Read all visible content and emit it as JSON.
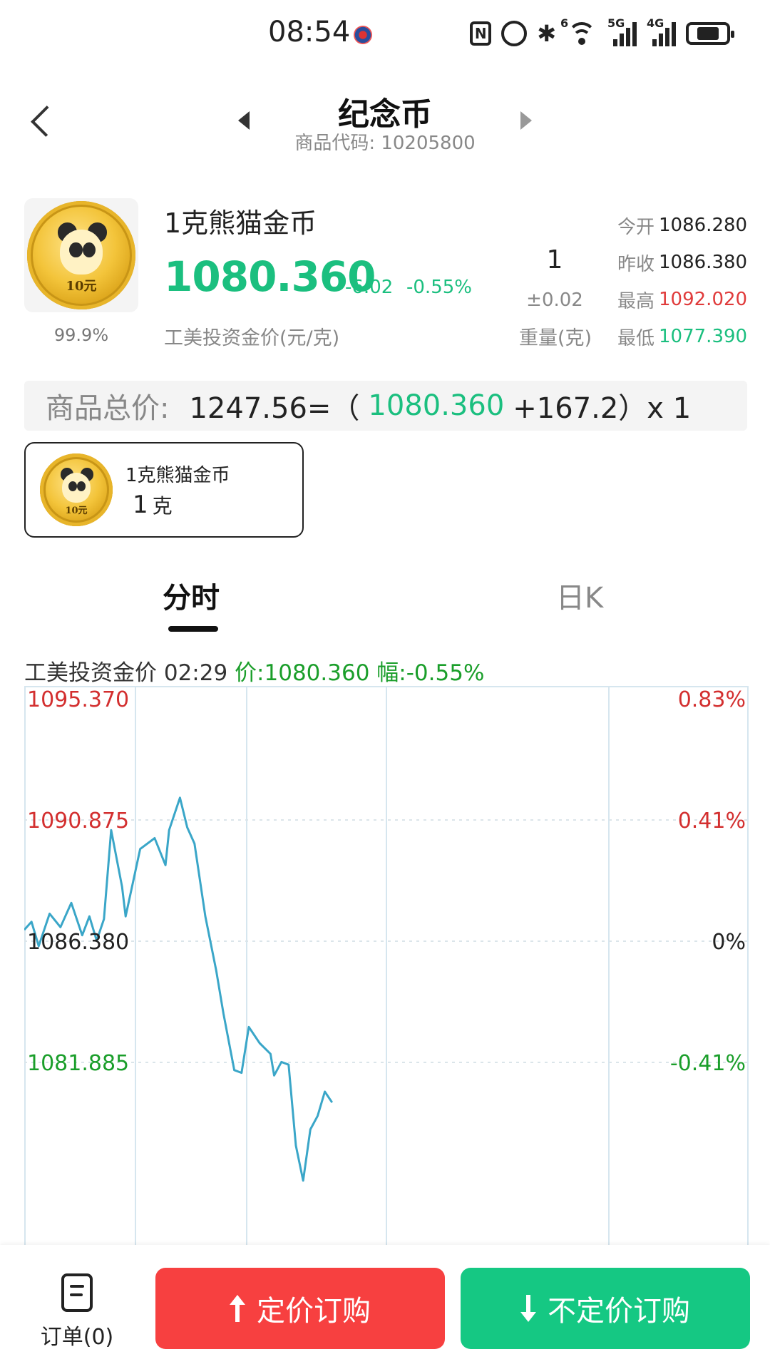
{
  "status_bar": {
    "time": "08:54",
    "icons": [
      "notification-badge-icon",
      "nfc-icon",
      "alarm-icon",
      "bluetooth-icon",
      "wifi-6-icon",
      "signal-5g-icon",
      "signal-4g-icon",
      "battery-icon"
    ],
    "wifi_tag": "6",
    "sim1_tag": "5G",
    "sim2_tag": "4G"
  },
  "header": {
    "title": "纪念币",
    "code_label": "商品代码:",
    "code_value": "10205800"
  },
  "product": {
    "name": "1克熊猫金币",
    "coin_face_text": "10元",
    "purity": "99.9%",
    "price": "1080.360",
    "change_abs": "-6.02",
    "change_pct": "-0.55%",
    "price_label": "工美投资金价(元/克)",
    "weight_value": "1",
    "weight_tolerance": "±0.02",
    "weight_label": "重量(克)",
    "stats": [
      {
        "label": "今开",
        "value": "1086.280",
        "color": "#222222"
      },
      {
        "label": "昨收",
        "value": "1086.380",
        "color": "#222222"
      },
      {
        "label": "最高",
        "value": "1092.020",
        "color": "#e03b3b"
      },
      {
        "label": "最低",
        "value": "1077.390",
        "color": "#1bbf7f"
      }
    ]
  },
  "total": {
    "label": "商品总价:",
    "total_eq": "1247.56=（",
    "unit_price": "1080.360",
    "extra": "+167.2）x 1"
  },
  "variant": {
    "name": "1克熊猫金币",
    "weight": "1",
    "unit": "克"
  },
  "tabs": [
    {
      "label": "分时",
      "active": true
    },
    {
      "label": "日K",
      "active": false
    }
  ],
  "chart_header": {
    "source": "工美投资金价",
    "time": "02:29",
    "price_text": "价:1080.360",
    "change_text": "幅:-0.55%"
  },
  "chart_data": {
    "type": "line",
    "title": "",
    "xlabel": "",
    "ylabel": "",
    "ylim": [
      1077.39,
      1095.37
    ],
    "baseline": 1086.38,
    "grid": true,
    "y_ticks_left": [
      {
        "value": 1095.37,
        "label": "1095.370",
        "color": "#d32f2f"
      },
      {
        "value": 1090.875,
        "label": "1090.875",
        "color": "#d32f2f"
      },
      {
        "value": 1086.38,
        "label": "1086.380",
        "color": "#222222"
      },
      {
        "value": 1081.885,
        "label": "1081.885",
        "color": "#1a9e2a"
      }
    ],
    "y_ticks_right": [
      {
        "value": 1095.37,
        "label": "0.83%",
        "color": "#d32f2f"
      },
      {
        "value": 1090.875,
        "label": "0.41%",
        "color": "#d32f2f"
      },
      {
        "value": 1086.38,
        "label": "0%",
        "color": "#222222"
      },
      {
        "value": 1081.885,
        "label": "-0.41%",
        "color": "#1a9e2a"
      }
    ],
    "x_fraction_of_session": [
      0.0,
      0.01,
      0.02,
      0.035,
      0.05,
      0.065,
      0.08,
      0.09,
      0.1,
      0.11,
      0.12,
      0.13,
      0.135,
      0.14,
      0.16,
      0.18,
      0.195,
      0.2,
      0.215,
      0.225,
      0.235,
      0.25,
      0.265,
      0.275,
      0.29,
      0.3,
      0.31,
      0.325,
      0.34,
      0.345,
      0.355,
      0.365,
      0.375,
      0.385,
      0.395,
      0.405,
      0.415,
      0.425
    ],
    "values": [
      1086.8,
      1087.1,
      1086.2,
      1087.4,
      1086.9,
      1087.8,
      1086.6,
      1087.3,
      1086.4,
      1087.2,
      1090.5,
      1089.1,
      1088.4,
      1087.3,
      1089.8,
      1090.2,
      1089.2,
      1090.5,
      1091.7,
      1090.6,
      1090.0,
      1087.3,
      1085.3,
      1083.7,
      1081.6,
      1081.5,
      1083.2,
      1082.6,
      1082.2,
      1081.4,
      1081.9,
      1081.8,
      1078.8,
      1077.5,
      1079.4,
      1079.9,
      1080.8,
      1080.4
    ],
    "line_color": "#3aa6c8"
  },
  "bottom": {
    "orders_label": "订单(0)",
    "fixed_price_button": "定价订购",
    "market_price_button": "不定价订购"
  },
  "colors": {
    "up": "#e03b3b",
    "down": "#1bbf7f",
    "buy_button": "#f74040",
    "market_button": "#15c883"
  }
}
